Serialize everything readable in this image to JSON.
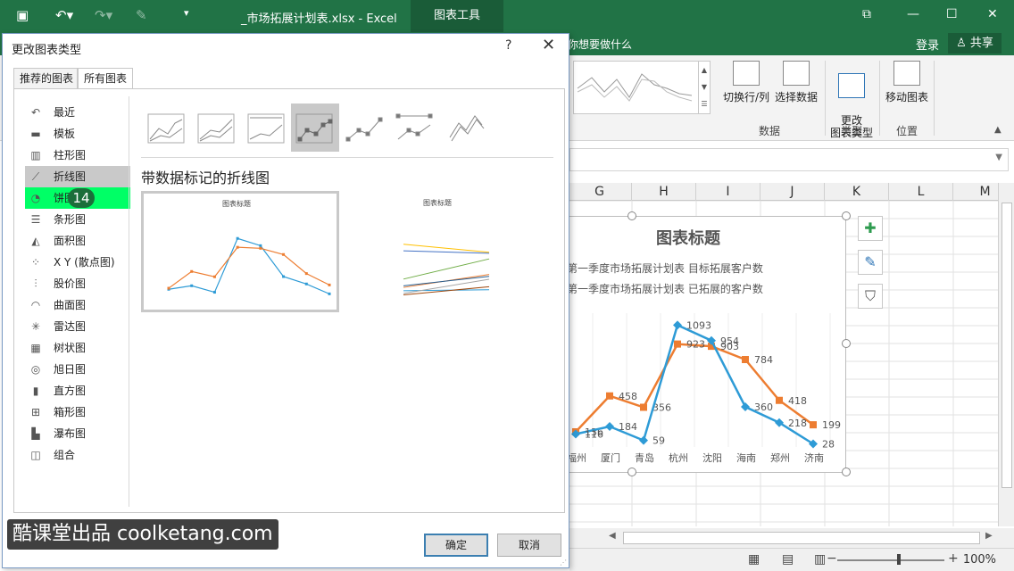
{
  "window": {
    "doc_title": "_市场拓展计划表.xlsx - Excel",
    "context_tab": "图表工具",
    "tell_me": "你想要做什么",
    "login": "登录",
    "share": "共享"
  },
  "ribbon": {
    "buttons": [
      {
        "label": "切换行/列",
        "name": "switch-row-col-button"
      },
      {
        "label": "选择数据",
        "name": "select-data-button"
      },
      {
        "label": "更改\n图表类型",
        "name": "change-chart-type-button"
      },
      {
        "label": "移动图表",
        "name": "move-chart-button"
      }
    ],
    "groups": [
      "数据",
      "类型",
      "位置"
    ]
  },
  "sheet": {
    "columns": [
      "G",
      "H",
      "I",
      "J",
      "K",
      "L",
      "M"
    ]
  },
  "chart": {
    "title": "图表标题",
    "legend": [
      "第一季度市场拓展计划表 目标拓展客户数",
      "第一季度市场拓展计划表 已拓展的客户数"
    ],
    "categories": [
      "福州",
      "厦门",
      "青岛",
      "杭州",
      "沈阳",
      "海南",
      "郑州",
      "济南"
    ],
    "series_blue": [
      116,
      184,
      59,
      1093,
      954,
      360,
      218,
      28
    ],
    "series_orange": [
      136,
      458,
      356,
      923,
      903,
      784,
      418,
      199
    ],
    "colors": {
      "blue": "#2e9bd6",
      "orange": "#ed7d31"
    }
  },
  "status": {
    "zoom": "100%"
  },
  "dialog": {
    "title": "更改图表类型",
    "help": "?",
    "tabs": [
      "推荐的图表",
      "所有图表"
    ],
    "types": [
      {
        "label": "最近",
        "icon": "recent-icon"
      },
      {
        "label": "模板",
        "icon": "folder-icon"
      },
      {
        "label": "柱形图",
        "icon": "column-chart-icon"
      },
      {
        "label": "折线图",
        "icon": "line-chart-icon"
      },
      {
        "label": "饼图",
        "icon": "pie-chart-icon"
      },
      {
        "label": "条形图",
        "icon": "bar-chart-icon"
      },
      {
        "label": "面积图",
        "icon": "area-chart-icon"
      },
      {
        "label": "X Y (散点图)",
        "icon": "scatter-chart-icon"
      },
      {
        "label": "股价图",
        "icon": "stock-chart-icon"
      },
      {
        "label": "曲面图",
        "icon": "surface-chart-icon"
      },
      {
        "label": "雷达图",
        "icon": "radar-chart-icon"
      },
      {
        "label": "树状图",
        "icon": "treemap-chart-icon"
      },
      {
        "label": "旭日图",
        "icon": "sunburst-chart-icon"
      },
      {
        "label": "直方图",
        "icon": "histogram-chart-icon"
      },
      {
        "label": "箱形图",
        "icon": "box-chart-icon"
      },
      {
        "label": "瀑布图",
        "icon": "waterfall-chart-icon"
      },
      {
        "label": "组合",
        "icon": "combo-chart-icon"
      }
    ],
    "selected_type": "折线图",
    "step_badge": "14",
    "subtype_heading": "带数据标记的折线图",
    "preview_title": "图表标题",
    "ok": "确定",
    "cancel": "取消"
  },
  "watermark": "酷课堂出品 coolketang.com"
}
